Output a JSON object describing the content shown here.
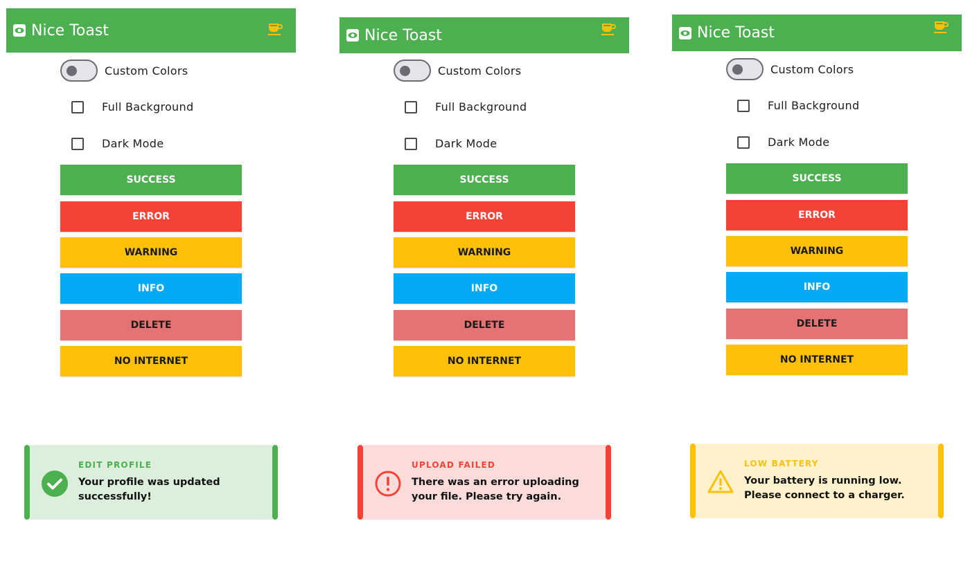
{
  "colors": {
    "appbar": "#4caf50",
    "success": "#4caf50",
    "error": "#f44336",
    "warning": "#ffc107",
    "info": "#03a9f4",
    "delete": "#e57373",
    "no_internet": "#ffc107",
    "cup_icon": "#ffc107"
  },
  "panels": [
    {
      "app_title": "Nice Toast",
      "toggle_label": "Custom Colors",
      "full_background_label": "Full Background",
      "dark_mode_label": "Dark Mode",
      "buttons": [
        "SUCCESS",
        "ERROR",
        "WARNING",
        "INFO",
        "DELETE",
        "NO INTERNET"
      ],
      "toast": {
        "type": "success",
        "icon": "check-circle-icon",
        "title": "EDIT PROFILE",
        "message_line1": "Your profile was updated",
        "message_line2": "successfully!",
        "accent": "#4caf50",
        "background": "#dcefdc"
      }
    },
    {
      "app_title": "Nice Toast",
      "toggle_label": "Custom Colors",
      "full_background_label": "Full Background",
      "dark_mode_label": "Dark Mode",
      "buttons": [
        "SUCCESS",
        "ERROR",
        "WARNING",
        "INFO",
        "DELETE",
        "NO INTERNET"
      ],
      "toast": {
        "type": "error",
        "icon": "exclamation-circle-icon",
        "title": "UPLOAD FAILED",
        "message_line1": "There was an error uploading",
        "message_line2": "your file. Please try again.",
        "accent": "#f44336",
        "background": "#fcdcda"
      }
    },
    {
      "app_title": "Nice Toast",
      "toggle_label": "Custom Colors",
      "full_background_label": "Full Background",
      "dark_mode_label": "Dark Mode",
      "buttons": [
        "SUCCESS",
        "ERROR",
        "WARNING",
        "INFO",
        "DELETE",
        "NO INTERNET"
      ],
      "toast": {
        "type": "warning",
        "icon": "warning-triangle-icon",
        "title": "LOW BATTERY",
        "message_line1": "Your battery is running low.",
        "message_line2": "Please connect to a charger.",
        "accent": "#ffc107",
        "background": "#fff2cc"
      }
    }
  ]
}
